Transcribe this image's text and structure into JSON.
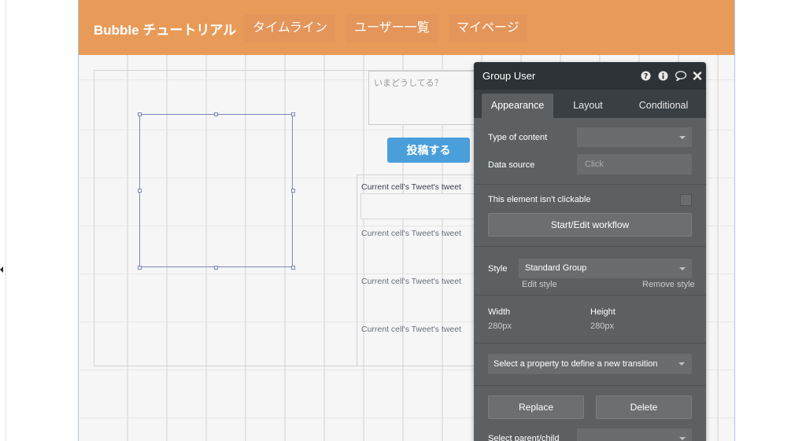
{
  "header": {
    "brand": "Bubble チュートリアル",
    "nav": [
      {
        "label": "タイムライン"
      },
      {
        "label": "ユーザー一覧"
      },
      {
        "label": "マイページ"
      }
    ],
    "color": "#e89b58"
  },
  "canvas": {
    "textarea_placeholder": "いまどうしてる？",
    "post_button": "投稿する",
    "cells": [
      "Current cell's Tweet's tweet",
      "Current cell's Tweet's tweet",
      "Current cell's Tweet's tweet",
      "Current cell's Tweet's tweet"
    ],
    "accent": "#4a9fdb"
  },
  "panel": {
    "title": "Group User",
    "icons": [
      "help-icon",
      "info-icon",
      "comment-icon",
      "close-icon"
    ],
    "tabs": [
      {
        "label": "Appearance",
        "active": true
      },
      {
        "label": "Layout",
        "active": false
      },
      {
        "label": "Conditional",
        "active": false
      }
    ],
    "type_of_content_label": "Type of content",
    "type_of_content_value": "",
    "data_source_label": "Data source",
    "data_source_placeholder": "Click",
    "not_clickable_label": "This element isn't clickable",
    "workflow_button": "Start/Edit workflow",
    "style_label": "Style",
    "style_value": "Standard Group",
    "edit_style": "Edit style",
    "remove_style": "Remove style",
    "width_label": "Width",
    "width_value": "280px",
    "height_label": "Height",
    "height_value": "280px",
    "transition_select": "Select a property to define a new transition",
    "replace_button": "Replace",
    "delete_button": "Delete",
    "select_parent_label": "Select parent/child"
  }
}
